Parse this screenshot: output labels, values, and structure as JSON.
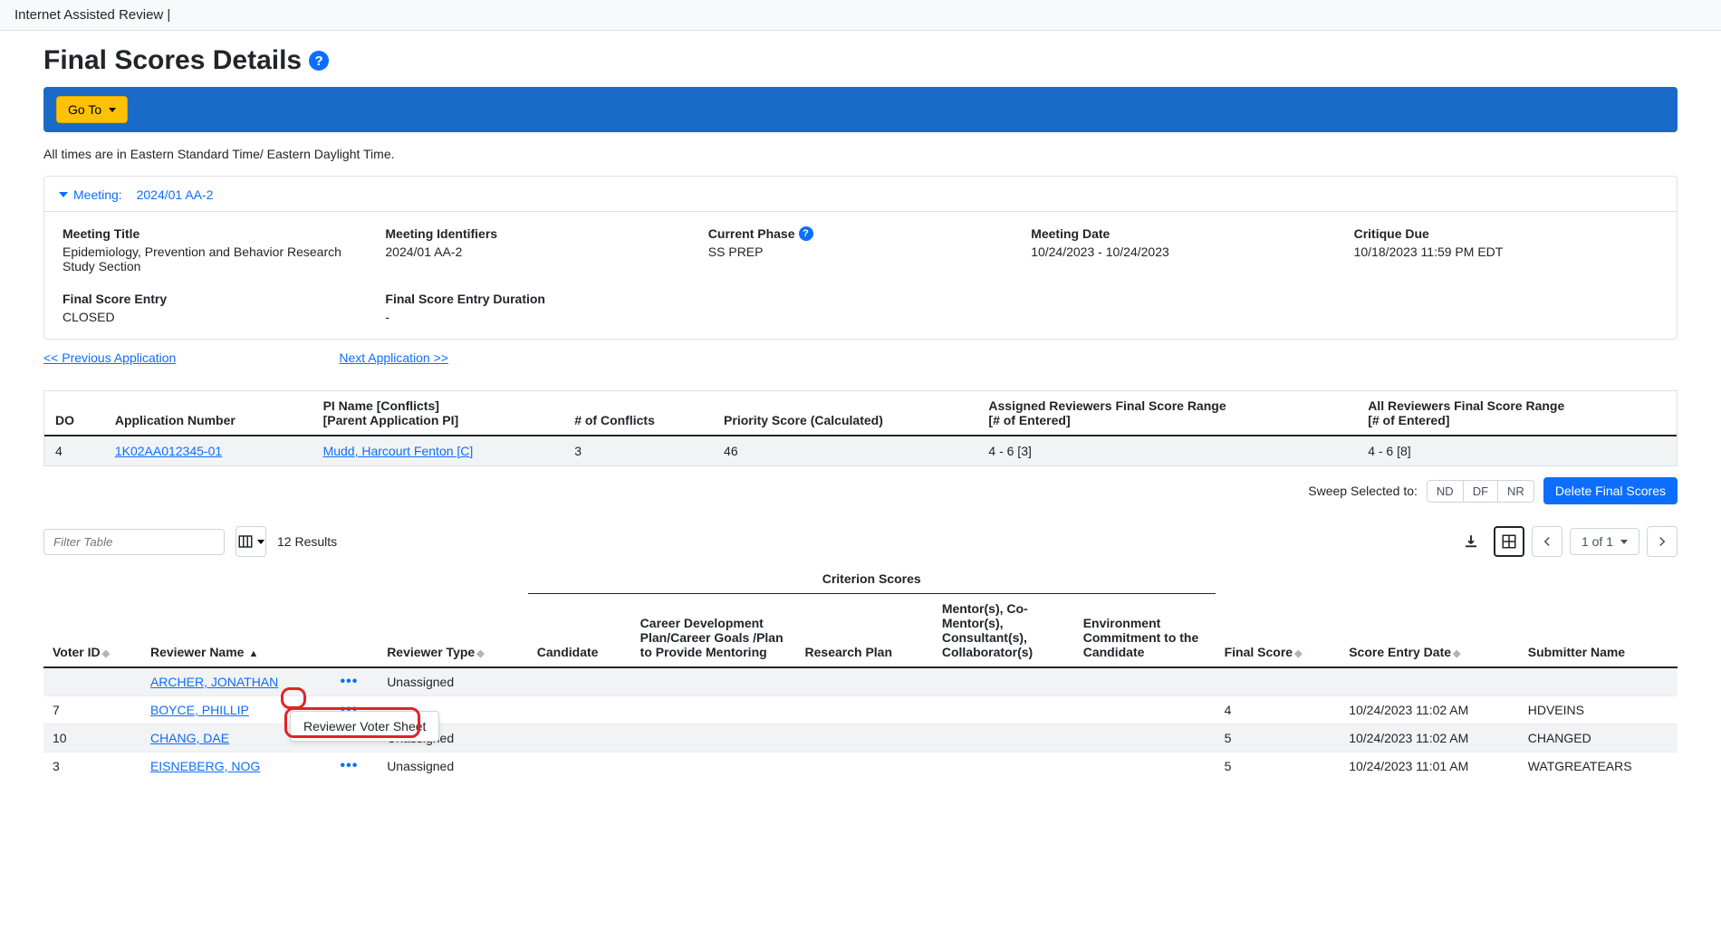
{
  "app_name": "Internet Assisted Review",
  "page_title": "Final Scores Details",
  "goto_label": "Go To",
  "tz_note": "All times are in Eastern Standard Time/ Eastern Daylight Time.",
  "meeting": {
    "header_prefix": "Meeting:",
    "header_id": "2024/01 AA-2",
    "fields": {
      "title_label": "Meeting Title",
      "title_value": "Epidemiology, Prevention and Behavior Research Study Section",
      "identifiers_label": "Meeting Identifiers",
      "identifiers_value": "2024/01 AA-2",
      "phase_label": "Current Phase",
      "phase_value": "SS PREP",
      "date_label": "Meeting Date",
      "date_value": "10/24/2023 - 10/24/2023",
      "critique_label": "Critique Due",
      "critique_value": "10/18/2023 11:59 PM EDT",
      "entry_label": "Final Score Entry",
      "entry_value": "CLOSED",
      "duration_label": "Final Score Entry Duration",
      "duration_value": "-"
    }
  },
  "nav": {
    "prev": "<< Previous Application",
    "next": "Next Application >>"
  },
  "app_table": {
    "headers": {
      "do": "DO",
      "app_num": "Application Number",
      "pi_name": "PI Name [Conflicts]",
      "pi_name2": "[Parent Application PI]",
      "conflicts": "# of Conflicts",
      "priority": "Priority Score (Calculated)",
      "assigned": "Assigned Reviewers Final Score Range",
      "assigned2": "[# of Entered]",
      "all": "All Reviewers Final Score Range",
      "all2": "[# of Entered]"
    },
    "row": {
      "do": "4",
      "app_num": "1K02AA012345-01",
      "pi_name": "Mudd, Harcourt Fenton [C]",
      "conflicts": "3",
      "priority": "46",
      "assigned": "4 -  6 [3]",
      "all": "4 -  6 [8]"
    }
  },
  "sweep": {
    "label": "Sweep Selected to:",
    "nd": "ND",
    "df": "DF",
    "nr": "NR",
    "delete": "Delete Final Scores"
  },
  "toolbar": {
    "filter_placeholder": "Filter Table",
    "results": "12 Results",
    "page_info": "1 of 1"
  },
  "score_table": {
    "group_header": "Criterion Scores",
    "headers": {
      "voter_id": "Voter ID",
      "reviewer_name": "Reviewer Name",
      "reviewer_type": "Reviewer Type",
      "candidate": "Candidate",
      "career": "Career Development Plan/Career Goals /Plan to Provide Mentoring",
      "research": "Research Plan",
      "mentors": "Mentor(s), Co-Mentor(s), Consultant(s), Collaborator(s)",
      "env": "Environment Commitment to the Candidate",
      "final": "Final Score",
      "entry_date": "Score Entry Date",
      "submitter": "Submitter Name"
    },
    "rows": [
      {
        "voter_id": "",
        "name": "ARCHER, JONATHAN",
        "type": "Unassigned",
        "final": "",
        "date": "",
        "submitter": ""
      },
      {
        "voter_id": "7",
        "name": "BOYCE, PHILLIP",
        "type": "",
        "final": "4",
        "date": "10/24/2023 11:02 AM",
        "submitter": "HDVEINS"
      },
      {
        "voter_id": "10",
        "name": "CHANG, DAE",
        "type": "Unassigned",
        "final": "5",
        "date": "10/24/2023 11:02 AM",
        "submitter": "CHANGED"
      },
      {
        "voter_id": "3",
        "name": "EISNEBERG, NOG",
        "type": "Unassigned",
        "final": "5",
        "date": "10/24/2023 11:01 AM",
        "submitter": "WATGREATEARS"
      }
    ]
  },
  "popup": {
    "item": "Reviewer Voter Sheet"
  }
}
